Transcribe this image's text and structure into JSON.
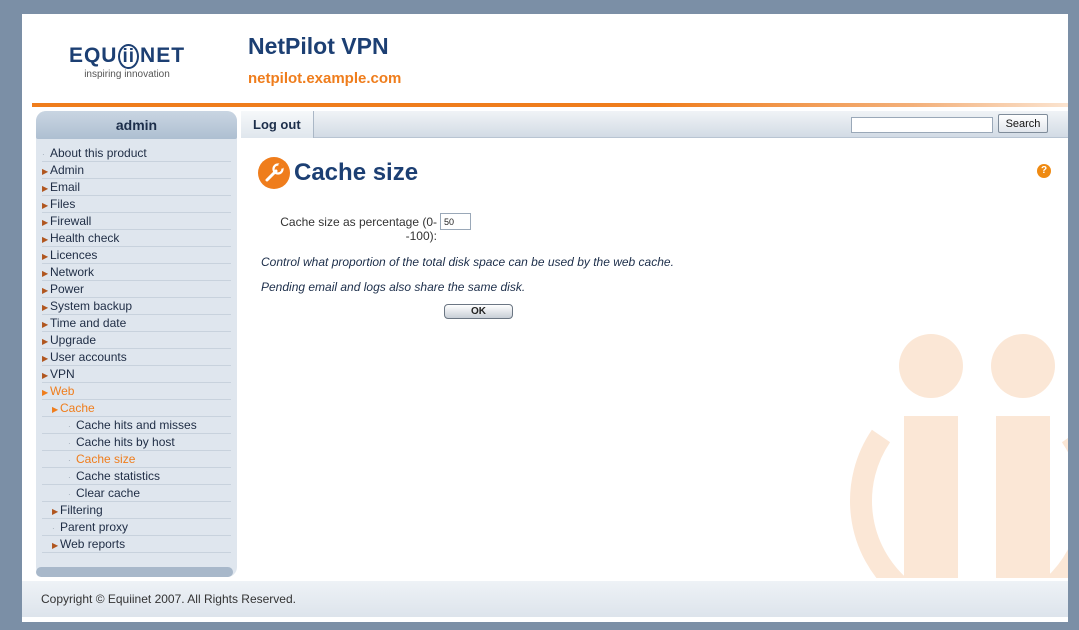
{
  "header": {
    "logo_brand": "EQUIINET",
    "logo_tagline": "inspiring innovation",
    "app_title": "NetPilot VPN",
    "host": "netpilot.example.com"
  },
  "sidebar": {
    "user": "admin",
    "items": [
      {
        "label": "About this product",
        "level": 1,
        "type": "leaf",
        "active": false
      },
      {
        "label": "Admin",
        "level": 1,
        "type": "folder",
        "active": false
      },
      {
        "label": "Email",
        "level": 1,
        "type": "folder",
        "active": false
      },
      {
        "label": "Files",
        "level": 1,
        "type": "folder",
        "active": false
      },
      {
        "label": "Firewall",
        "level": 1,
        "type": "folder",
        "active": false
      },
      {
        "label": "Health check",
        "level": 1,
        "type": "folder",
        "active": false
      },
      {
        "label": "Licences",
        "level": 1,
        "type": "folder",
        "active": false
      },
      {
        "label": "Network",
        "level": 1,
        "type": "folder",
        "active": false
      },
      {
        "label": "Power",
        "level": 1,
        "type": "folder",
        "active": false
      },
      {
        "label": "System backup",
        "level": 1,
        "type": "folder",
        "active": false
      },
      {
        "label": "Time and date",
        "level": 1,
        "type": "folder",
        "active": false
      },
      {
        "label": "Upgrade",
        "level": 1,
        "type": "folder",
        "active": false
      },
      {
        "label": "User accounts",
        "level": 1,
        "type": "folder",
        "active": false
      },
      {
        "label": "VPN",
        "level": 1,
        "type": "folder",
        "active": false
      },
      {
        "label": "Web",
        "level": 1,
        "type": "folder",
        "active": true
      },
      {
        "label": "Cache",
        "level": 2,
        "type": "folder",
        "active": true
      },
      {
        "label": "Cache hits and misses",
        "level": 3,
        "type": "leaf",
        "active": false
      },
      {
        "label": "Cache hits by host",
        "level": 3,
        "type": "leaf",
        "active": false
      },
      {
        "label": "Cache size",
        "level": 3,
        "type": "leaf",
        "active": true
      },
      {
        "label": "Cache statistics",
        "level": 3,
        "type": "leaf",
        "active": false
      },
      {
        "label": "Clear cache",
        "level": 3,
        "type": "leaf",
        "active": false
      },
      {
        "label": "Filtering",
        "level": 2,
        "type": "folder",
        "active": false
      },
      {
        "label": "Parent proxy",
        "level": 2,
        "type": "leaf",
        "active": false
      },
      {
        "label": "Web reports",
        "level": 2,
        "type": "folder",
        "active": false
      }
    ]
  },
  "toolbar": {
    "logout_label": "Log out",
    "search_value": "",
    "search_button_label": "Search"
  },
  "main": {
    "title": "Cache size",
    "help_label": "?",
    "field_label": "Cache size as percentage (0--100):",
    "field_value": "50",
    "description_1": "Control what proportion of the total disk space can be used by the web cache.",
    "description_2": "Pending email and logs also share the same disk.",
    "ok_label": "OK"
  },
  "footer": {
    "copyright": "Copyright © Equiinet 2007. All Rights Reserved."
  },
  "colors": {
    "brand_blue": "#1c3f73",
    "accent_orange": "#ef7d1c",
    "sidebar_bg": "#dfe6ee",
    "frame_bg": "#7b8fa6"
  },
  "icons": {
    "page_icon": "wrench-icon",
    "help_icon": "help-icon",
    "folder_item_icon": "arrow-bullet-icon",
    "leaf_item_icon": "dot-bullet-icon"
  }
}
